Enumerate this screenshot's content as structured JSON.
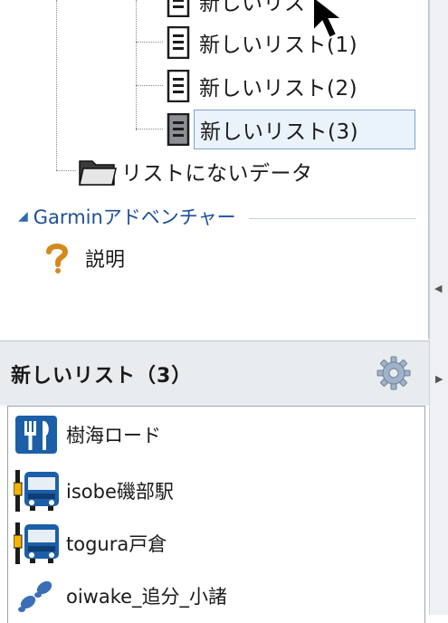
{
  "tree": {
    "partial_item_label": "新しいリスト",
    "items": [
      {
        "label": "新しいリスト(1)"
      },
      {
        "label": "新しいリスト(2)"
      },
      {
        "label": "新しいリスト(3)"
      }
    ],
    "unlisted_label": "リストにないデータ"
  },
  "section": {
    "label": "Garminアドベンチャー"
  },
  "help": {
    "label": "説明"
  },
  "list": {
    "title": "新しいリスト（3）",
    "items": [
      {
        "label": "樹海ロード",
        "icon": "restaurant-icon"
      },
      {
        "label": "isobe磯部駅",
        "icon": "bus-stop-icon"
      },
      {
        "label": "togura戸倉",
        "icon": "bus-stop-icon"
      },
      {
        "label": "oiwake_追分_小諸",
        "icon": "footprints-icon"
      }
    ]
  },
  "colors": {
    "accent": "#1f4f9a",
    "selection_border": "#7da2ce",
    "poi_blue": "#1c5fa8",
    "header_bg": "#e9ecef"
  }
}
